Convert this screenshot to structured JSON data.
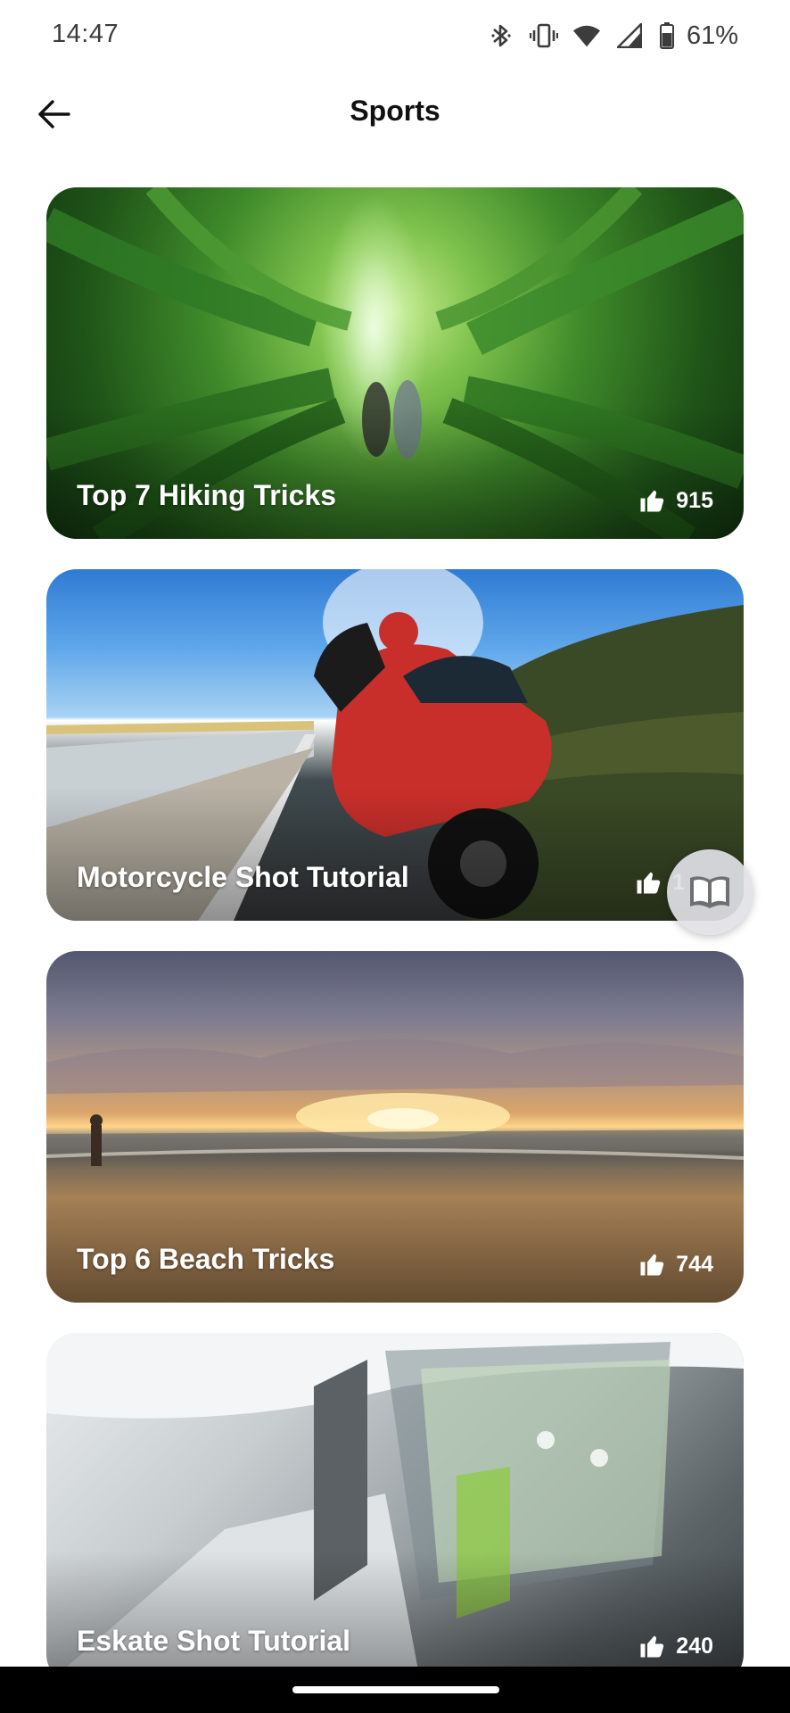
{
  "status_bar": {
    "time": "14:47",
    "battery": "61%",
    "icons": [
      "bluetooth-icon",
      "vibrate-icon",
      "wifi-icon",
      "signal-icon",
      "battery-icon"
    ]
  },
  "header": {
    "title": "Sports",
    "back_icon": "arrow-left-icon"
  },
  "cards": [
    {
      "title": "Top 7 Hiking Tricks",
      "likes": "915",
      "image": "forest canopy"
    },
    {
      "title": "Motorcycle Shot Tutorial",
      "likes": "1",
      "image": "red motorcycle on coastal road"
    },
    {
      "title": "Top 6 Beach Tricks",
      "likes": "744",
      "image": "sunset beach"
    },
    {
      "title": "Eskate Shot Tutorial",
      "likes": "240",
      "image": "indoor hallway"
    }
  ],
  "fab": {
    "icon": "book-icon"
  },
  "colors": {
    "background": "#ffffff",
    "text": "#111111",
    "card_text": "#ffffff"
  }
}
